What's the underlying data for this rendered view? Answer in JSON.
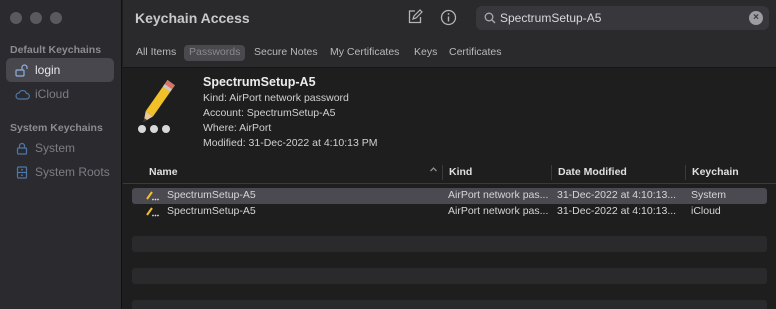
{
  "window": {
    "title": "Keychain Access"
  },
  "sidebar": {
    "sections": [
      {
        "title": "Default Keychains",
        "items": [
          {
            "label": "login",
            "icon": "lock-open-icon",
            "selected": true
          },
          {
            "label": "iCloud",
            "icon": "cloud-icon",
            "selected": false
          }
        ]
      },
      {
        "title": "System Keychains",
        "items": [
          {
            "label": "System",
            "icon": "lock-icon",
            "selected": false
          },
          {
            "label": "System Roots",
            "icon": "cabinet-icon",
            "selected": false
          }
        ]
      }
    ]
  },
  "toolbar": {
    "compose_icon": "compose-icon",
    "info_icon": "info-icon"
  },
  "search": {
    "value": "SpectrumSetup-A5",
    "placeholder": "Search"
  },
  "tabs": [
    {
      "label": "All Items",
      "active": false
    },
    {
      "label": "Passwords",
      "active": true
    },
    {
      "label": "Secure Notes",
      "active": false
    },
    {
      "label": "My Certificates",
      "active": false
    },
    {
      "label": "Keys",
      "active": false
    },
    {
      "label": "Certificates",
      "active": false
    }
  ],
  "detail": {
    "name": "SpectrumSetup-A5",
    "kind": "Kind: AirPort network password",
    "account": "Account: SpectrumSetup-A5",
    "where": "Where: AirPort",
    "modified": "Modified: 31-Dec-2022 at 4:10:13 PM"
  },
  "table": {
    "columns": [
      "Name",
      "Kind",
      "Date Modified",
      "Keychain"
    ],
    "rows": [
      {
        "name": "SpectrumSetup-A5",
        "kind": "AirPort network pas...",
        "date": "31-Dec-2022 at 4:10:13...",
        "keychain": "System",
        "selected": true
      },
      {
        "name": "SpectrumSetup-A5",
        "kind": "AirPort network pas...",
        "date": "31-Dec-2022 at 4:10:13...",
        "keychain": "iCloud",
        "selected": false
      }
    ]
  },
  "colors": {
    "accent_selection": "#4b4a50",
    "sidebar_bg": "#2b2a2f",
    "window_bg": "#1e1e1e"
  }
}
